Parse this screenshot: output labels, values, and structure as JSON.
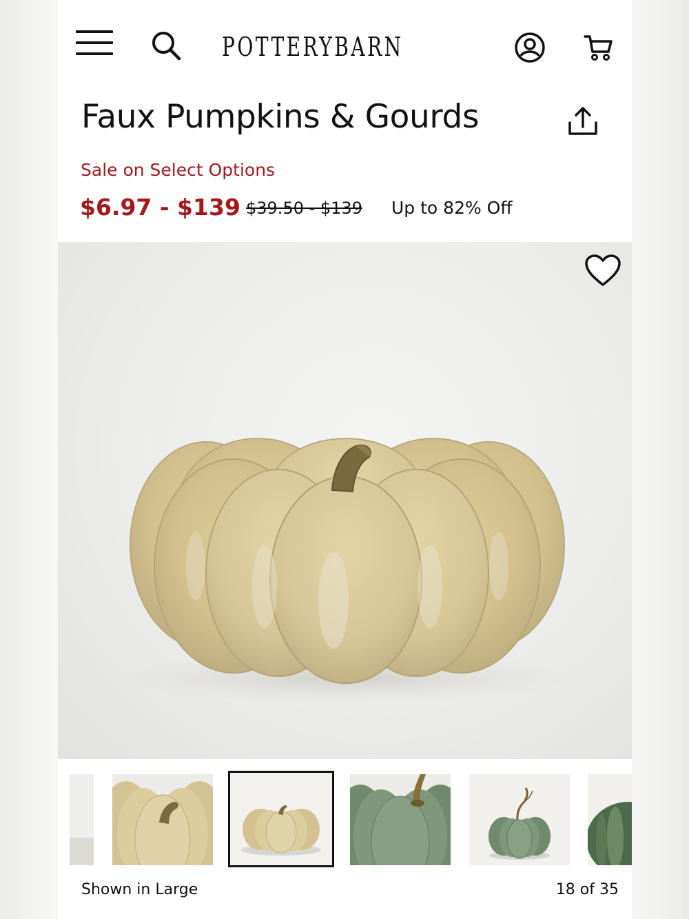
{
  "header": {
    "logo": "POTTERYBARN",
    "icons": {
      "menu": "hamburger-menu-icon",
      "search": "search-icon",
      "account": "user-account-icon",
      "cart": "shopping-cart-icon"
    }
  },
  "product": {
    "title": "Faux Pumpkins & Gourds",
    "sale_label": "Sale on Select Options",
    "sale_price": "$6.97 - $139",
    "original_price": "$39.50 - $139",
    "discount": "Up to 82% Off"
  },
  "actions": {
    "share_icon": "share-upload-icon",
    "favorite_icon": "heart-icon"
  },
  "gallery": {
    "caption": "Shown in Large",
    "counter": "18 of 35",
    "thumbnails": [
      "partial-thumbnail",
      "cream-pumpkin-closeup",
      "cream-pumpkin-full",
      "green-pumpkin-closeup",
      "green-pumpkin-full",
      "green-pumpkin-partial"
    ],
    "selected_index": 2
  },
  "colors": {
    "sale_red": "#a4181b",
    "text": "#111111",
    "pumpkin_cream": "#d8c79a",
    "pumpkin_green": "#7c9378"
  }
}
